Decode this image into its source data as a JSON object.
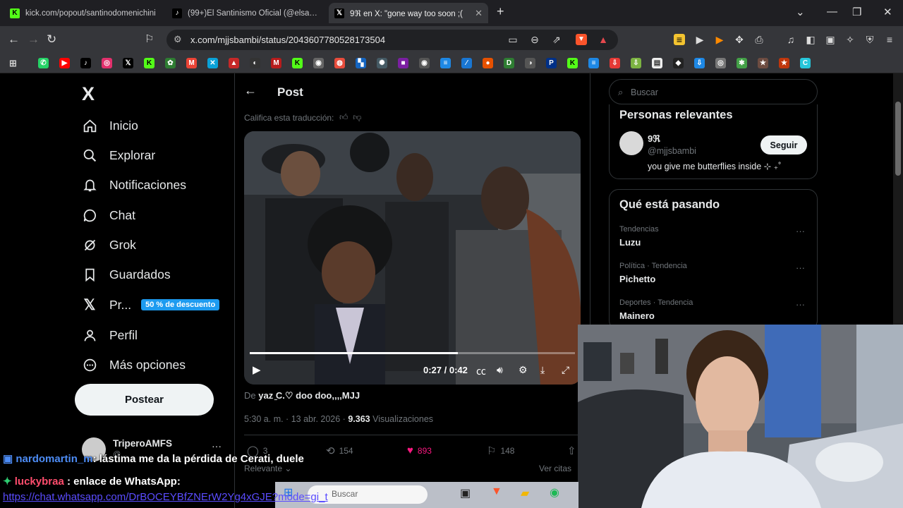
{
  "browser": {
    "tabs": [
      {
        "title": "kick.com/popout/santinodomenichini",
        "icon": "kick-icon"
      },
      {
        "title": "(99+)El Santinismo Oficial (@elsantinismo",
        "icon": "tiktok-icon"
      },
      {
        "title": "9ℜ en X: \"gone way too soon ;(",
        "icon": "x-icon"
      }
    ],
    "new_tab": "+",
    "url": "x.com/mjjsbambi/status/2043607780528173504"
  },
  "sidebar": {
    "logo": "X",
    "items": [
      {
        "label": "Inicio",
        "icon": "home-icon"
      },
      {
        "label": "Explorar",
        "icon": "search-icon"
      },
      {
        "label": "Notificaciones",
        "icon": "bell-icon"
      },
      {
        "label": "Chat",
        "icon": "chat-icon"
      },
      {
        "label": "Grok",
        "icon": "grok-icon"
      },
      {
        "label": "Guardados",
        "icon": "bookmark-icon"
      },
      {
        "label": "Pr...",
        "icon": "x-premium-icon",
        "badge": "50 % de descuento"
      },
      {
        "label": "Perfil",
        "icon": "person-icon"
      },
      {
        "label": "Más opciones",
        "icon": "more-icon"
      }
    ],
    "post_button": "Postear",
    "account": {
      "name": "TriperoAMFS",
      "handle": "@...",
      "more": "···"
    }
  },
  "post": {
    "header": "Post",
    "rate_translation": "Califica esta traducción:",
    "video": {
      "current": "0:27",
      "total": "0:42",
      "time_label": "0:27 / 0:42",
      "progress": 0.64
    },
    "from_prefix": "De",
    "from_user": "yaz ̫C.♡ doo doo,,,,MJJ",
    "timestamp": "5:30 a. m. · 13 abr. 2026 ·",
    "views": "9.363",
    "views_label": "Visualizaciones",
    "actions": {
      "replies": "3",
      "reposts": "154",
      "likes": "893",
      "bookmarks": "148"
    },
    "relevant": "Relevante",
    "ver_citas": "Ver citas"
  },
  "right": {
    "search_placeholder": "Buscar",
    "relevant_title": "Personas relevantes",
    "person": {
      "name": "9ℜ",
      "handle": "@mjjsbambi",
      "bio": "you give me butterflies inside ⊹ ₊˚",
      "follow": "Seguir"
    },
    "trending_title": "Qué está pasando",
    "trends": [
      {
        "context": "Tendencias",
        "name": "Luzu"
      },
      {
        "context": "Política · Tendencia",
        "name": "Pichetto"
      },
      {
        "context": "Deportes · Tendencia",
        "name": "Mainero"
      }
    ]
  },
  "chat": [
    {
      "user": "nardomartin_m",
      "text": ": lástima me da la pérdida de Cerati, duele"
    },
    {
      "user": "luckybraa",
      "text": " : enlace de WhatsApp:"
    },
    {
      "link": "https://chat.whatsapp.com/DrBOCEYBfZNErW2Yg4xGJE?mode=gi_t"
    }
  ],
  "taskbar": {
    "search": "Buscar"
  }
}
